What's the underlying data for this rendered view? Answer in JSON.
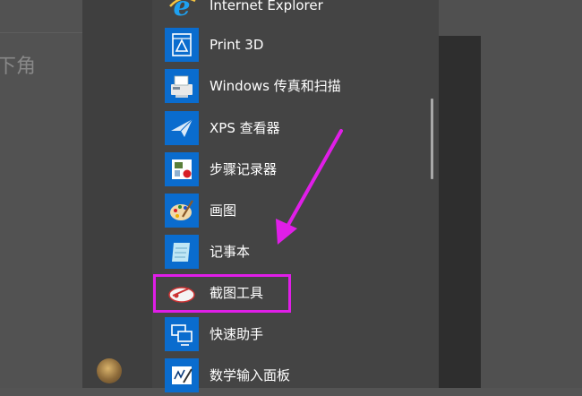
{
  "background_document": {
    "partial_text": "下角"
  },
  "start_menu": {
    "items": [
      {
        "label": "Internet Explorer",
        "icon": "internet-explorer-icon",
        "name": "internet-explorer"
      },
      {
        "label": "Print 3D",
        "icon": "print-3d-icon",
        "name": "print-3d"
      },
      {
        "label": "Windows 传真和扫描",
        "icon": "fax-scanner-icon",
        "name": "windows-fax-scan"
      },
      {
        "label": "XPS 查看器",
        "icon": "xps-viewer-icon",
        "name": "xps-viewer"
      },
      {
        "label": "步骤记录器",
        "icon": "steps-recorder-icon",
        "name": "steps-recorder"
      },
      {
        "label": "画图",
        "icon": "paint-palette-icon",
        "name": "paint"
      },
      {
        "label": "记事本",
        "icon": "notepad-icon",
        "name": "notepad"
      },
      {
        "label": "截图工具",
        "icon": "snipping-tool-icon",
        "name": "snipping-tool"
      },
      {
        "label": "快速助手",
        "icon": "quick-assist-icon",
        "name": "quick-assist"
      },
      {
        "label": "数学输入面板",
        "icon": "math-input-panel-icon",
        "name": "math-input-panel"
      }
    ],
    "highlighted_item": "截图工具"
  },
  "colors": {
    "tile_blue": "#0a6cce",
    "highlight_magenta": "#e01ee8",
    "menu_bg": "#444444",
    "label_white": "#ffffff"
  }
}
